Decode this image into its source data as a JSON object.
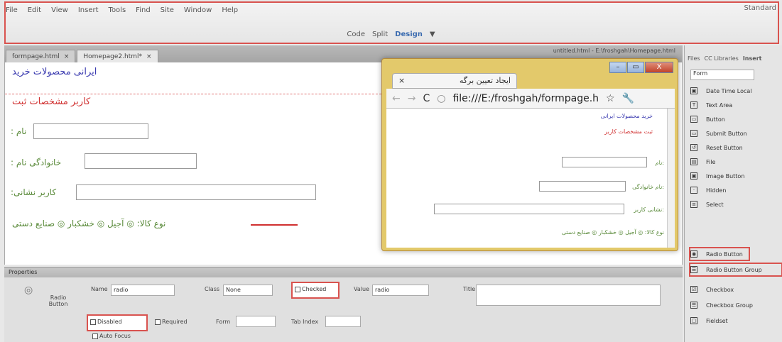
{
  "menu": {
    "items": [
      "File",
      "Edit",
      "View",
      "Insert",
      "Tools",
      "Find",
      "Site",
      "Window",
      "Help"
    ],
    "workspace": "Standard"
  },
  "views": {
    "code": "Code",
    "split": "Split",
    "design": "Design"
  },
  "tabs": [
    {
      "label": "formpage.html"
    },
    {
      "label": "Homepage2.html*"
    }
  ],
  "docpath": "untitled.html - E:\\froshgah\\Homepage.html",
  "form": {
    "title": "ایرانی محصولات خرید",
    "subtitle": "کاربر مشخصات ثبت",
    "name_label": ": نام",
    "family_label": ": خانوادگی نام",
    "address_label": ":کاربر نشانی",
    "type_label": "نوع کالا: ◎ آجیل ◎ خشکبار ◎ صنایع دستی"
  },
  "browser": {
    "tab": "ایجاد تعیین برگه",
    "url": "file:///E:/froshgah/formpage.h",
    "page_title": "خرید محصولات ایرانی",
    "page_subtitle": "ثبت مشخصات کاربر",
    "l1": "نام:",
    "l2": "نام خانوادگی:",
    "l3": "نشانی کاربر:",
    "l4": "نوع کالا: ◎ آجیل ◎ خشکبار ◎ صنایع دستی"
  },
  "insert_panel": {
    "tabs": [
      "Files",
      "CC Libraries",
      "Insert"
    ],
    "category": "Form",
    "items": [
      {
        "label": "Date Time Local",
        "icon": "▣"
      },
      {
        "label": "Text Area",
        "icon": "T"
      },
      {
        "label": "Button",
        "icon": "▭"
      },
      {
        "label": "Submit Button",
        "icon": "▭"
      },
      {
        "label": "Reset Button",
        "icon": "↺"
      },
      {
        "label": "File",
        "icon": "▤"
      },
      {
        "label": "Image Button",
        "icon": "▣"
      },
      {
        "label": "Hidden",
        "icon": "·"
      },
      {
        "label": "Select",
        "icon": "≡"
      },
      {
        "label": "Radio Button",
        "icon": "◉"
      },
      {
        "label": "Radio Button Group",
        "icon": "☰"
      },
      {
        "label": "Checkbox",
        "icon": "☑"
      },
      {
        "label": "Checkbox Group",
        "icon": "☰"
      },
      {
        "label": "Fieldset",
        "icon": "▢"
      }
    ]
  },
  "properties": {
    "header": "Properties",
    "type_label": "Radio Button",
    "name_label": "Name",
    "name_value": "radio",
    "class_label": "Class",
    "class_value": "None",
    "checked": "Checked",
    "value_label": "Value",
    "value_value": "radio",
    "title_label": "Title",
    "disabled": "Disabled",
    "required": "Required",
    "form_label": "Form",
    "tabindex_label": "Tab Index",
    "autofocus": "Auto Focus"
  }
}
